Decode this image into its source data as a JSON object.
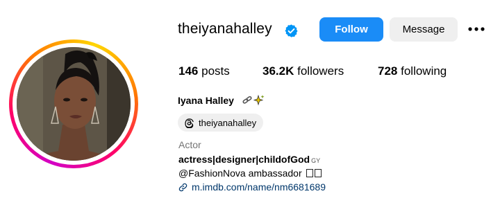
{
  "profile": {
    "username": "theiyanahalley",
    "verified": true,
    "full_name": "Iyana Halley",
    "category": "Actor",
    "threads_handle": "theiyanahalley",
    "bio_line1": "actress|designer|childofGod",
    "bio_line1_suffix": "GY",
    "bio_line2": "@FashionNova ambassador",
    "link": "m.imdb.com/name/nm6681689"
  },
  "actions": {
    "follow_label": "Follow",
    "message_label": "Message"
  },
  "stats": {
    "posts_count": "146",
    "posts_label": "posts",
    "followers_count": "36.2K",
    "followers_label": "followers",
    "following_count": "728",
    "following_label": "following"
  },
  "colors": {
    "follow_button": "#1a8cf7",
    "message_button": "#efefef",
    "verified_badge": "#0095f6",
    "category_text": "#737373",
    "link_text": "#00376b"
  },
  "icons": {
    "verified": "verified-badge-icon",
    "more": "more-options-icon",
    "threads": "threads-icon",
    "link": "link-icon"
  }
}
